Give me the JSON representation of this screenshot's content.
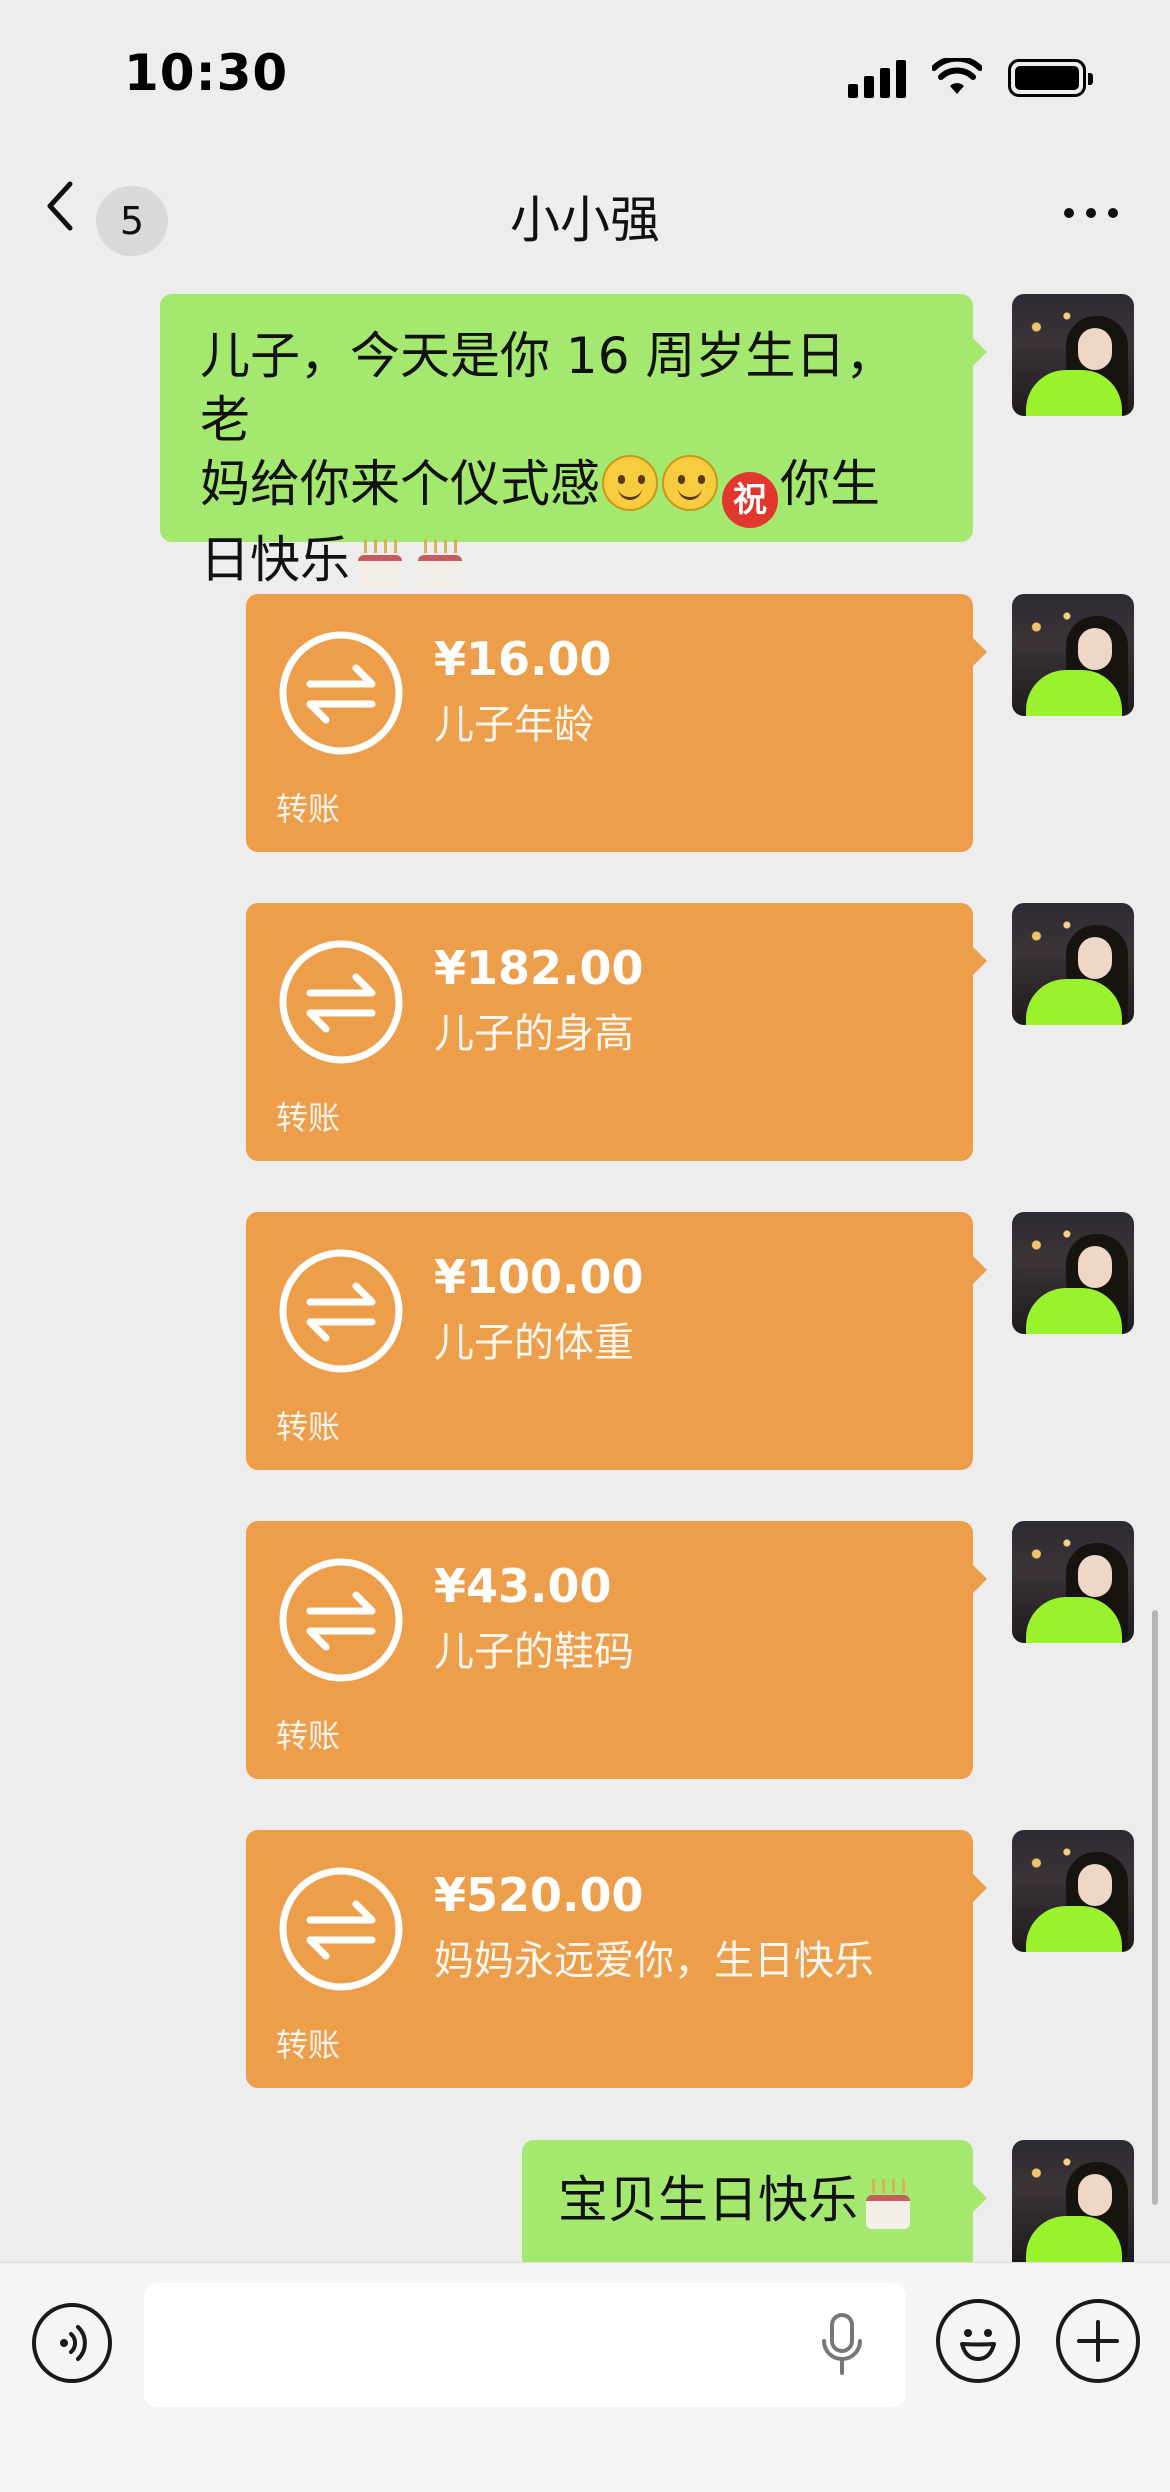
{
  "status_bar": {
    "time": "10:30"
  },
  "nav": {
    "unread_count": "5",
    "title": "小小强"
  },
  "messages": {
    "text1": {
      "line1": "儿子，今天是你 16 周岁生日，老",
      "line2": "妈给你来个仪式感",
      "zhu": "祝",
      "line2b": "你生",
      "line3": "日快乐"
    },
    "transfers": [
      {
        "amount": "¥16.00",
        "note": "儿子年龄",
        "label": "转账"
      },
      {
        "amount": "¥182.00",
        "note": "儿子的身高",
        "label": "转账"
      },
      {
        "amount": "¥100.00",
        "note": "儿子的体重",
        "label": "转账"
      },
      {
        "amount": "¥43.00",
        "note": "儿子的鞋码",
        "label": "转账"
      },
      {
        "amount": "¥520.00",
        "note": "妈妈永远爱你，生日快乐",
        "label": "转账"
      }
    ],
    "text2": "宝贝生日快乐"
  },
  "input": {
    "value": ""
  },
  "colors": {
    "green_bubble": "#a4e86f",
    "transfer_bubble": "#ed9e4a",
    "background": "#ededed"
  },
  "icons": [
    "back-icon",
    "more-icon",
    "transfer-icon",
    "voice-icon",
    "mic-icon",
    "emoji-icon",
    "plus-icon",
    "smile-emoji",
    "cake-emoji"
  ]
}
